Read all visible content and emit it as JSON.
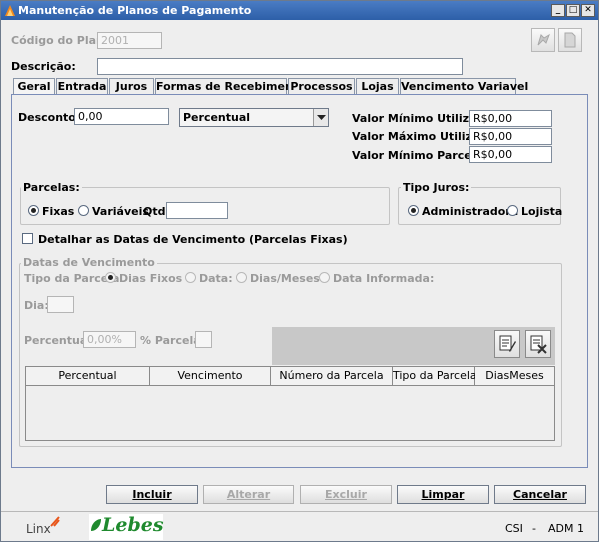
{
  "window": {
    "title": "Manutenção de Planos de Pagamento",
    "buttons": [
      "_",
      "□",
      "✕"
    ]
  },
  "header": {
    "codigo_label": "Código do Plano:",
    "codigo_value": "2001",
    "descricao_label": "Descrição:",
    "descricao_value": ""
  },
  "tabs": [
    "Geral",
    "Entrada",
    "Juros",
    "Formas de Recebimento",
    "Processos",
    "Lojas",
    "Vencimento Variavel"
  ],
  "geral": {
    "desconto_label": "Desconto:",
    "desconto_value": "0,00",
    "tipo_desconto": "Percentual",
    "valor_min_util_label": "Valor Mínimo Utilização:",
    "valor_min_util_value": "R$0,00",
    "valor_max_util_label": "Valor Máximo Utilização:",
    "valor_max_util_value": "R$0,00",
    "valor_min_parcela_label": "Valor Mínimo Parcela:",
    "valor_min_parcela_value": "R$0,00"
  },
  "parcelas": {
    "label": "Parcelas:",
    "fixas": "Fixas",
    "variaveis": "Variáveis",
    "qtd_label": "Qtd",
    "qtd_value": ""
  },
  "tipo_juros": {
    "label": "Tipo Juros:",
    "administradora": "Administradora",
    "lojista": "Lojista"
  },
  "detalhar_label": "Detalhar as Datas de Vencimento (Parcelas Fixas)",
  "datas_vencimento": {
    "label": "Datas de Vencimento",
    "tipo_parcela_label": "Tipo da Parcela",
    "dias_fixos": "Dias Fixos :",
    "data": "Data:",
    "dias_meses": "Dias/Meses",
    "data_informada": "Data Informada:",
    "dia_label": "Dia:",
    "percentual_label": "Percentual:",
    "percentual_value": "0,00%",
    "parcela_label": "% Parcela:"
  },
  "table": {
    "columns": [
      "Percentual",
      "Vencimento",
      "Número da Parcela",
      "Tipo da Parcela",
      "DiasMeses"
    ],
    "rows": []
  },
  "actions": {
    "incluir": "Incluir",
    "alterar": "Alterar",
    "excluir": "Excluir",
    "limpar": "Limpar",
    "cancelar": "Cancelar"
  },
  "status": {
    "brand_linx": "Linx",
    "brand_lebes": "Lebes",
    "system": "CSI",
    "separator": "-",
    "user": "ADM 1"
  },
  "colors": {
    "titlebar": "#2d5fa8",
    "panel_border": "#7a8cb8",
    "lebes_green": "#1f8a2e"
  }
}
